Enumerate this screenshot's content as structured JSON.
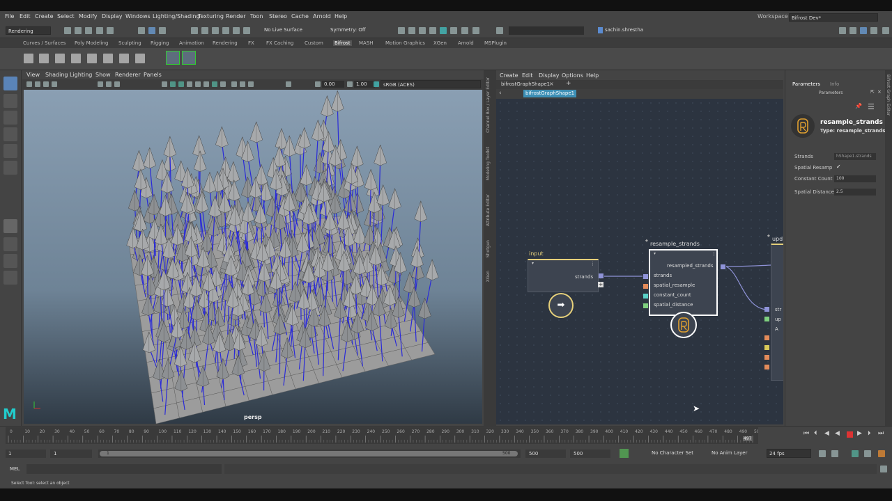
{
  "menu": [
    "File",
    "Edit",
    "Create",
    "Select",
    "Modify",
    "Display",
    "Windows",
    "Lighting/Shading",
    "Texturing",
    "Render",
    "Toon",
    "Stereo",
    "Cache",
    "Arnold",
    "Help"
  ],
  "workspace": {
    "label": "Workspace :",
    "value": "Bifrost Dev*"
  },
  "status": {
    "mode": "Rendering",
    "live_surface": "No Live Surface",
    "symmetry": "Symmetry: Off",
    "user": "sachin.shrestha"
  },
  "shelf_tabs": [
    "Curves / Surfaces",
    "Poly Modeling",
    "Sculpting",
    "Rigging",
    "Animation",
    "Rendering",
    "FX",
    "FX Caching",
    "Custom",
    "Bifrost",
    "MASH",
    "Motion Graphics",
    "XGen",
    "Arnold",
    "MSPlugin"
  ],
  "viewport": {
    "menu": [
      "View",
      "Shading",
      "Lighting",
      "Show",
      "Renderer",
      "Panels"
    ],
    "exposure": "0.00",
    "gamma": "1.00",
    "color_space": "sRGB (ACES)",
    "camera": "persp"
  },
  "side_tabs": [
    "Channel Box / Layer Editor",
    "Modeling Toolkit",
    "Attribute Editor",
    "Shotgun",
    "XGen"
  ],
  "graph_editor": {
    "menu": [
      "Create",
      "Edit",
      "Display",
      "Options",
      "Help"
    ],
    "tab": "bifrostGraphShape1",
    "crumb": "bifrostGraphShape1",
    "input_node": {
      "title": "input",
      "port": "strands"
    },
    "resample_node": {
      "title": "resample_strands",
      "output": "resampled_strands",
      "ports": [
        "strands",
        "spatial_resample",
        "constant_count",
        "spatial_distance"
      ]
    },
    "partial_node": {
      "title": "upd",
      "ports": [
        "str",
        "up",
        "A"
      ]
    }
  },
  "right_strip": "Bifrost Graph Editor",
  "params": {
    "tabs": [
      "Parameters",
      "Info"
    ],
    "header": "Parameters",
    "node_name": "resample_strands",
    "node_type": "Type: resample_strands",
    "rows": [
      {
        "label": "Strands",
        "value": "hShape1.strands"
      },
      {
        "label": "Spatial Resamp",
        "value": "✓"
      },
      {
        "label": "Constant Count",
        "value": "100"
      },
      {
        "label": "Spatial Distance",
        "value": "2.5"
      }
    ]
  },
  "timeline": {
    "ticks": [
      "0",
      "10",
      "20",
      "30",
      "40",
      "50",
      "60",
      "70",
      "80",
      "90",
      "100",
      "110",
      "120",
      "130",
      "140",
      "150",
      "160",
      "170",
      "180",
      "190",
      "200",
      "210",
      "220",
      "230",
      "240",
      "250",
      "260",
      "270",
      "280",
      "290",
      "300",
      "310",
      "320",
      "330",
      "340",
      "350",
      "360",
      "370",
      "380",
      "390",
      "400",
      "410",
      "420",
      "430",
      "440",
      "450",
      "460",
      "470",
      "480",
      "490",
      "50"
    ],
    "current": "497"
  },
  "range": {
    "start": "1",
    "start2": "1",
    "slider_start": "1",
    "slider_end": "500",
    "end": "500",
    "end2": "500",
    "char_set": "No Character Set",
    "anim_layer": "No Anim Layer",
    "fps": "24 fps"
  },
  "mel": {
    "label": "MEL"
  },
  "status_text": "Select Tool: select an object"
}
